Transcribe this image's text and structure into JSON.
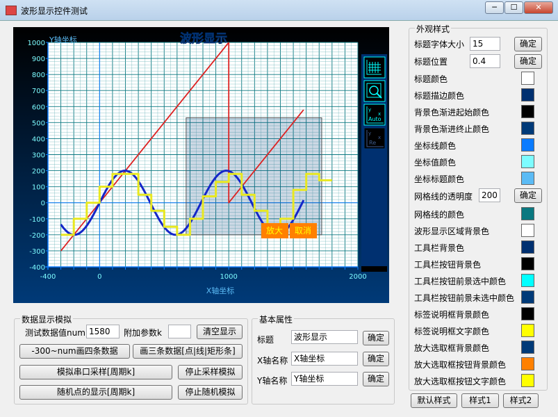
{
  "window": {
    "title": "波形显示控件测试",
    "minimize": "─",
    "maximize": "☐",
    "close": "✕"
  },
  "chart_data": {
    "type": "line",
    "title": "波形显示",
    "xlabel": "X轴坐标",
    "ylabel": "Y轴坐标",
    "xlim": [
      -400,
      2000
    ],
    "ylim": [
      -400,
      1000
    ],
    "x_ticks": [
      "-400",
      "0",
      "1000",
      "2000"
    ],
    "y_ticks": [
      "1000",
      "900",
      "800",
      "700",
      "600",
      "500",
      "400",
      "300",
      "200",
      "100",
      "0",
      "-100",
      "-200",
      "-300",
      "-400"
    ],
    "series": [
      {
        "type": "line",
        "color": "#dd2222",
        "points": [
          [
            -300,
            -300
          ],
          [
            1000,
            1000
          ],
          [
            1000,
            0
          ],
          [
            1580,
            580
          ]
        ]
      },
      {
        "type": "sine",
        "color": "#1426c8",
        "x_start": -300,
        "x_end": 1580,
        "amplitude": 200,
        "period": 785
      },
      {
        "type": "step",
        "color": "#e8e820",
        "points": [
          [
            -300,
            -200
          ],
          [
            -200,
            -200
          ],
          [
            -200,
            -100
          ],
          [
            -100,
            -100
          ],
          [
            -100,
            0
          ],
          [
            0,
            0
          ],
          [
            0,
            100
          ],
          [
            100,
            100
          ],
          [
            100,
            180
          ],
          [
            300,
            180
          ],
          [
            300,
            50
          ],
          [
            400,
            50
          ],
          [
            400,
            -50
          ],
          [
            500,
            -50
          ],
          [
            500,
            -150
          ],
          [
            600,
            -150
          ],
          [
            600,
            -200
          ],
          [
            700,
            -200
          ],
          [
            700,
            -100
          ],
          [
            800,
            -100
          ],
          [
            800,
            40
          ],
          [
            900,
            40
          ],
          [
            900,
            130
          ],
          [
            1000,
            130
          ],
          [
            1000,
            180
          ],
          [
            1100,
            180
          ],
          [
            1100,
            50
          ],
          [
            1200,
            50
          ],
          [
            1200,
            -50
          ],
          [
            1300,
            -50
          ],
          [
            1300,
            -200
          ],
          [
            1400,
            -200
          ],
          [
            1400,
            -100
          ],
          [
            1500,
            -100
          ],
          [
            1500,
            80
          ],
          [
            1600,
            80
          ],
          [
            1600,
            180
          ],
          [
            1700,
            180
          ],
          [
            1700,
            140
          ],
          [
            1800,
            140
          ]
        ]
      }
    ],
    "selection": {
      "x": [
        670,
        1720
      ],
      "y": [
        -200,
        530
      ]
    },
    "zoom_buttons": {
      "zoom_in": "放大",
      "cancel": "取消"
    }
  },
  "toolbar": {
    "icons": [
      "grid-icon",
      "zoom-icon",
      "auto-scale-icon",
      "reset-icon"
    ],
    "auto_label": "Auto",
    "re_label": "Re"
  },
  "sim": {
    "group_title": "数据显示模拟",
    "count_label": "测试数据值num",
    "count_value": "1580",
    "param_label": "附加参数k",
    "param_value": "",
    "clear_btn": "清空显示",
    "btn_four": "-300~num画四条数据",
    "btn_three": "画三条数据[点|线|矩形条]",
    "btn_serial": "模拟串口采样[周期k]",
    "btn_stop_sample": "停止采样模拟",
    "btn_random": "随机点的显示[周期k]",
    "btn_stop_random": "停止随机模拟"
  },
  "basic": {
    "group_title": "基本属性",
    "title_label": "标题",
    "title_value": "波形显示",
    "x_label": "X轴名称",
    "x_value": "X轴坐标",
    "y_label": "Y轴名称",
    "y_value": "Y轴坐标",
    "ok": "确定"
  },
  "appearance": {
    "group_title": "外观样式",
    "title_font_label": "标题字体大小",
    "title_font_value": "15",
    "title_pos_label": "标题位置",
    "title_pos_value": "0.4",
    "grid_alpha_label": "网格线的透明度",
    "grid_alpha_value": "200",
    "ok": "确定",
    "colors": [
      {
        "label": "标题颜色",
        "color": "#ffffff"
      },
      {
        "label": "标题描边颜色",
        "color": "#003070"
      },
      {
        "label": "背景色渐进起始颜色",
        "color": "#000000"
      },
      {
        "label": "背景色渐进终止颜色",
        "color": "#003a78"
      },
      {
        "label": "坐标线颜色",
        "color": "#0a7bff"
      },
      {
        "label": "坐标值颜色",
        "color": "#7dfcff"
      },
      {
        "label": "坐标标题颜色",
        "color": "#5bbbf5"
      }
    ],
    "colors2": [
      {
        "label": "网格线的颜色",
        "color": "#0a7880"
      },
      {
        "label": "波形显示区域背景色",
        "color": "#ffffff"
      },
      {
        "label": "工具栏背景色",
        "color": "#003070"
      },
      {
        "label": "工具栏按钮背景色",
        "color": "#000000"
      },
      {
        "label": "工具栏按钮前景选中颜色",
        "color": "#00ffff"
      },
      {
        "label": "工具栏按钮前景未选中颜色",
        "color": "#003a78"
      },
      {
        "label": "标签说明框背景颜色",
        "color": "#000000"
      },
      {
        "label": "标签说明框文字颜色",
        "color": "#ffff00"
      },
      {
        "label": "放大选取框背景颜色",
        "color": "#003a78"
      },
      {
        "label": "放大选取框按钮背景颜色",
        "color": "#ff8000"
      },
      {
        "label": "放大选取框按钮文字颜色",
        "color": "#ffff00"
      }
    ],
    "default_btn": "默认样式",
    "style1_btn": "样式1",
    "style2_btn": "样式2"
  }
}
